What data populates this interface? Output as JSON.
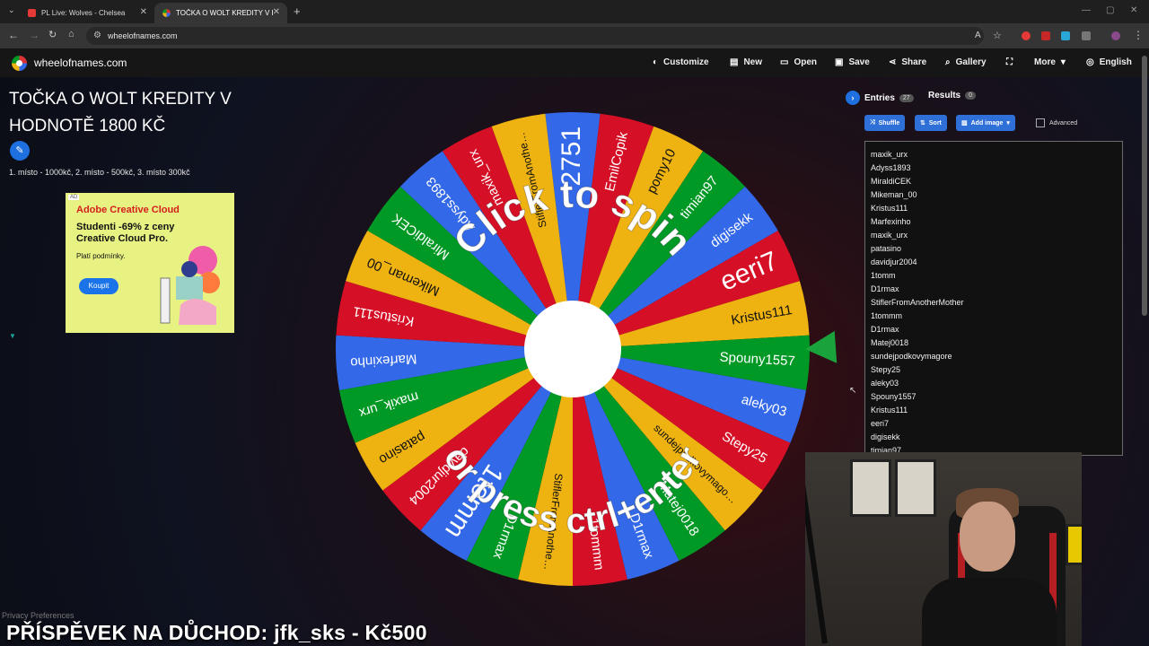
{
  "browser": {
    "tabs": [
      {
        "label": "PL Live: Wolves - Chelsea"
      },
      {
        "label": "TOČKA O WOLT KREDITY V HO"
      }
    ],
    "url": "wheelofnames.com"
  },
  "header": {
    "site_name": "wheelofnames.com",
    "menu": {
      "customize": "Customize",
      "new": "New",
      "open": "Open",
      "save": "Save",
      "share": "Share",
      "gallery": "Gallery",
      "more": "More",
      "language": "English"
    }
  },
  "wheel_page": {
    "title": "TOČKA O WOLT KREDITY V HODNOTĚ 1800 KČ",
    "description": "1. místo - 1000kč, 2. místo - 500kč, 3. místo 300kč",
    "spin_text_top": "Click to spin",
    "spin_text_bottom": "or press ctrl+enter"
  },
  "ad": {
    "tag": "AD",
    "brand": "Adobe Creative Cloud",
    "headline": "Studenti -69% z ceny Creative Cloud Pro.",
    "sub": "Platí podmínky.",
    "button": "Koupit"
  },
  "panel": {
    "entries_tab": "Entries",
    "entries_count": "27",
    "results_tab": "Results",
    "results_count": "0",
    "shuffle": "Shuffle",
    "sort": "Sort",
    "add_image": "Add image",
    "advanced": "Advanced",
    "entries": [
      "maxik_urx",
      "Adyss1893",
      "MiraldiCEK",
      "Mikeman_00",
      "Kristus111",
      "Marfexinho",
      "maxik_urx",
      "patasino",
      "davidjur2004",
      "1tomm",
      "D1rmax",
      "StiflerFromAnotherMother",
      "1tommm",
      "D1rmax",
      "Matej0018",
      "sundejpodkovymagore",
      "Stepy25",
      "aleky03",
      "Spouny1557",
      "Kristus111",
      "eeri7",
      "digisekk",
      "timian97"
    ]
  },
  "wheel": {
    "colors": [
      "#3369e8",
      "#d50f25",
      "#eeb211",
      "#009925"
    ],
    "segments": [
      "2751",
      "EmilCopik",
      "pomy10",
      "timian97",
      "digisekk",
      "eeri7",
      "Kristus111",
      "Spouny1557",
      "aleky03",
      "Stepy25",
      "sundejpodkovymagore",
      "Matej0018",
      "D1rmax",
      "1tommm",
      "StiflerFromAnotherMother",
      "D1rmax",
      "1tomm",
      "davidjur2004",
      "patasino",
      "maxik_urx",
      "Marfexinho",
      "Kristus111",
      "Mikeman_00",
      "MiraldiCEK",
      "Adyss1893",
      "maxik_urx",
      "StiflerFromAnotherMother"
    ]
  },
  "overlay": {
    "banner": "PŘÍSPĚVEK NA DŮCHOD: jfk_sks - Kč500",
    "privacy": "Privacy Preferences"
  }
}
